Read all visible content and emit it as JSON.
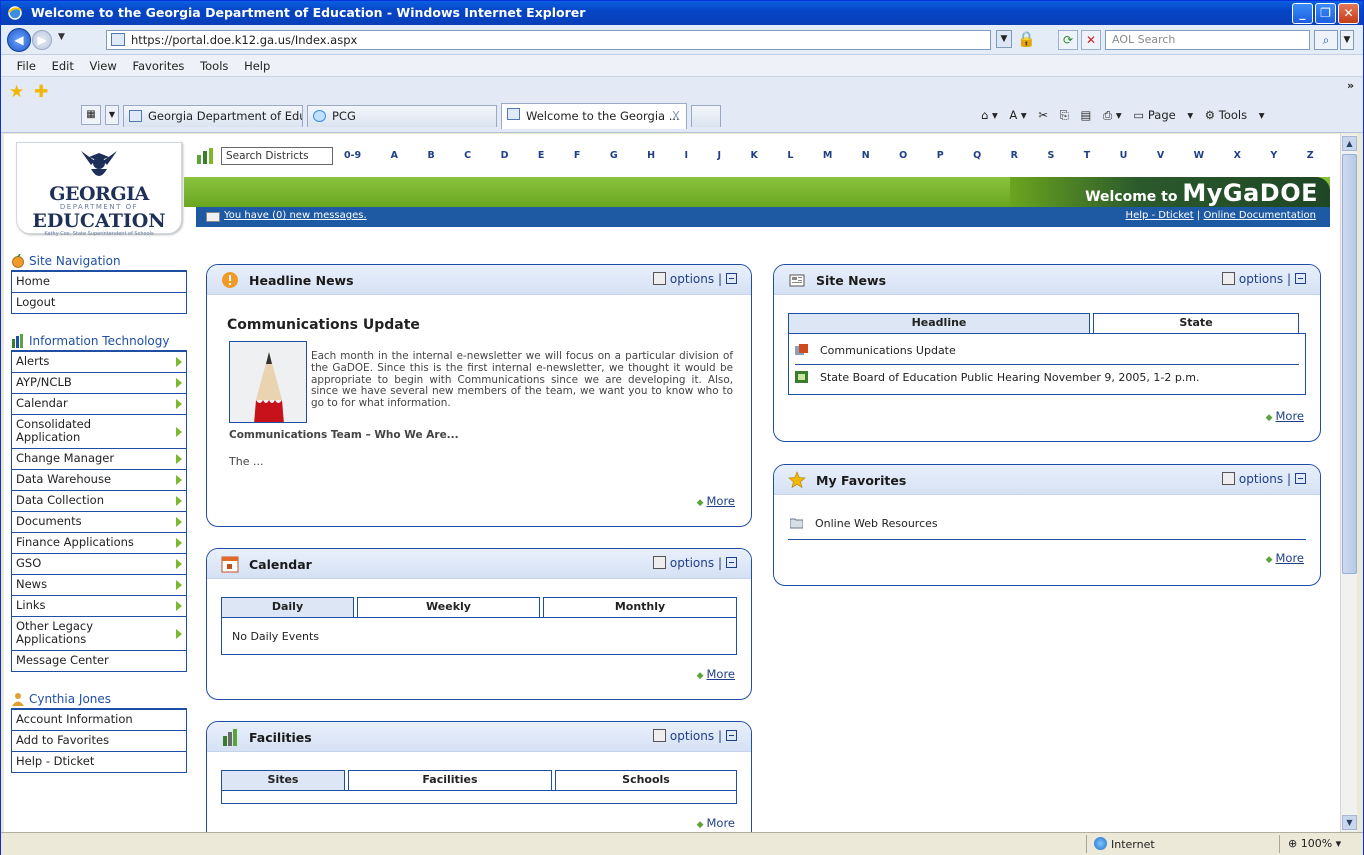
{
  "browser": {
    "title": "Welcome to the Georgia Department of Education - Windows Internet Explorer",
    "url": "https://portal.doe.k12.ga.us/Index.aspx",
    "search_placeholder": "AOL Search",
    "menu": [
      "File",
      "Edit",
      "View",
      "Favorites",
      "Tools",
      "Help"
    ],
    "tabs": [
      {
        "label": "Georgia Department of Educ..."
      },
      {
        "label": "PCG"
      },
      {
        "label": "Welcome to the Georgia ..."
      }
    ],
    "tab_close": "X",
    "toolbar_right": {
      "page": "Page",
      "tools": "Tools"
    },
    "status": {
      "zone": "Internet",
      "zoom": "100%"
    }
  },
  "header": {
    "logo": {
      "line1": "GEORGIA",
      "line2": "DEPARTMENT OF",
      "line3": "EDUCATION",
      "line4": "Kathy Cox, State Superintendent of Schools"
    },
    "district_search_placeholder": "Search Districts",
    "letters": [
      "0-9",
      "A",
      "B",
      "C",
      "D",
      "E",
      "F",
      "G",
      "H",
      "I",
      "J",
      "K",
      "L",
      "M",
      "N",
      "O",
      "P",
      "Q",
      "R",
      "S",
      "T",
      "U",
      "V",
      "W",
      "X",
      "Y",
      "Z"
    ],
    "welcome_small": "Welcome to",
    "welcome_big": "MyGaDOE",
    "messages_link": "You have (0) new messages.",
    "help_link": "Help - Dticket",
    "help_sep": "|",
    "docs_link": "Online Documentation"
  },
  "leftnav": {
    "site_navigation": {
      "title": "Site Navigation",
      "items": [
        "Home",
        "Logout"
      ]
    },
    "it": {
      "title": "Information Technology",
      "items": [
        "Alerts",
        "AYP/NCLB",
        "Calendar",
        "Consolidated Application",
        "Change Manager",
        "Data Warehouse",
        "Data Collection",
        "Documents",
        "Finance Applications",
        "GSO",
        "News",
        "Links",
        "Other Legacy Applications",
        "Message Center"
      ]
    },
    "user": {
      "title": "Cynthia Jones",
      "items": [
        "Account Information",
        "Add to Favorites",
        "Help - Dticket"
      ]
    }
  },
  "portlets": {
    "options_label": "options",
    "options_sep": "|",
    "more_label": "More",
    "headline_news": {
      "title": "Headline News",
      "article_title": "Communications Update",
      "body": "Each month in the internal e-newsletter we will focus on a particular division of the GaDOE. Since this is the first internal e-newsletter, we thought it would be appropriate to begin with Communications since we are developing it. Also, since we have several new members of the team, we want you to know who to go to for what information.",
      "subhead": "Communications Team – Who We Are...",
      "trail": "The ..."
    },
    "calendar": {
      "title": "Calendar",
      "tabs": [
        "Daily",
        "Weekly",
        "Monthly"
      ],
      "empty": "No Daily Events"
    },
    "facilities": {
      "title": "Facilities",
      "tabs": [
        "Sites",
        "Facilities",
        "Schools"
      ]
    },
    "site_news": {
      "title": "Site News",
      "tabs": [
        "Headline",
        "State"
      ],
      "items": [
        "Communications Update",
        "State Board of Education Public Hearing November 9, 2005, 1-2 p.m."
      ]
    },
    "my_favorites": {
      "title": "My Favorites",
      "items": [
        "Online Web Resources"
      ]
    }
  }
}
